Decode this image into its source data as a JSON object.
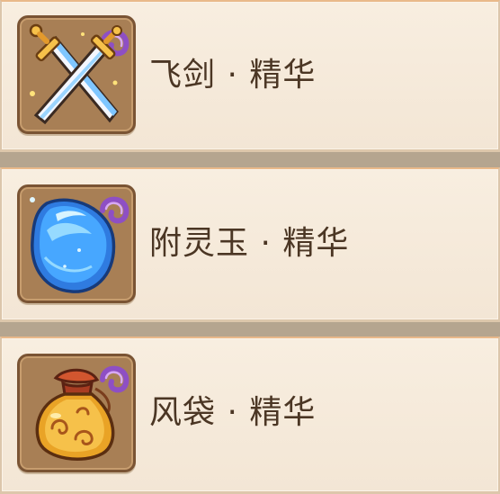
{
  "items": [
    {
      "name": "飞剑 · 精华",
      "icon": "flying-sword-icon"
    },
    {
      "name": "附灵玉 · 精华",
      "icon": "spirit-jade-icon"
    },
    {
      "name": "风袋 · 精华",
      "icon": "wind-bag-icon"
    }
  ],
  "colors": {
    "row_bg": "#f5e9d8",
    "row_border_top": "#e9b98a",
    "icon_frame": "#a87f55",
    "text": "#4b3624",
    "essence_swirl": "#9b59c8"
  }
}
